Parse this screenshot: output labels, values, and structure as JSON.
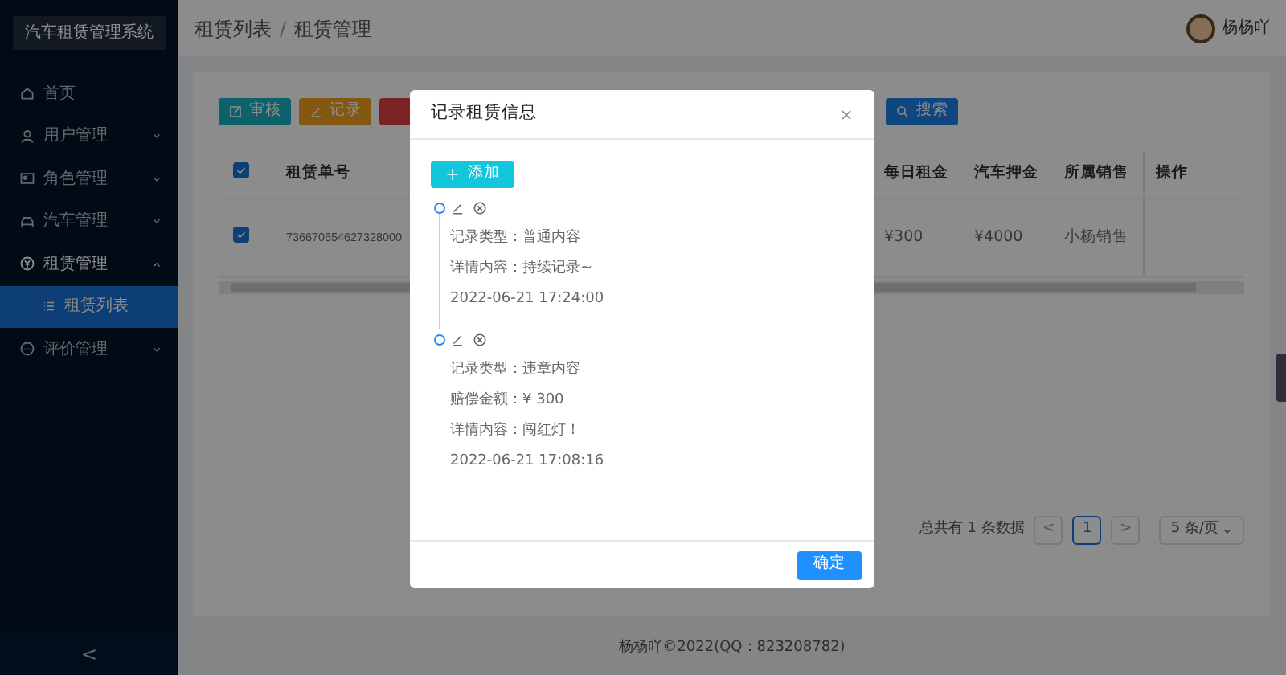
{
  "sidebar": {
    "title": "汽车租赁管理系统",
    "collapse": "<",
    "items": [
      {
        "label": "首页",
        "selected": false
      },
      {
        "label": "用户管理",
        "selected": false,
        "expanded": false
      },
      {
        "label": "角色管理",
        "selected": false,
        "expanded": false
      },
      {
        "label": "汽车管理",
        "selected": false,
        "expanded": false
      },
      {
        "label": "租赁管理",
        "selected": false,
        "expanded": true,
        "children": [
          {
            "label": "租赁列表",
            "selected": true
          }
        ]
      },
      {
        "label": "评价管理",
        "selected": false,
        "expanded": false
      }
    ]
  },
  "header": {
    "breadcrumb": [
      "租赁列表",
      "租赁管理"
    ],
    "breadcrumb_separator": "/",
    "user": "杨杨吖"
  },
  "toolbar": [
    {
      "kind": "review",
      "label": "审核"
    },
    {
      "kind": "record",
      "label": "记录"
    },
    {
      "kind": "delete"
    },
    {
      "kind": "search",
      "label": "搜索"
    }
  ],
  "table": {
    "select_all": {
      "checked": true
    },
    "columns": [
      "租赁单号",
      "每日租金",
      "汽车押金",
      "所属销售",
      "操作"
    ],
    "rows": [
      {
        "checked": true,
        "cells": [
          "736670654627328000",
          "¥300",
          "¥4000",
          "小杨销售"
        ]
      }
    ]
  },
  "pagination": {
    "total": "总共有 1 条数据",
    "prev": "<",
    "pages": [
      {
        "label": "1",
        "selected": true
      }
    ],
    "next": ">",
    "page_size": "5 条/页"
  },
  "footer": "杨杨吖©2022(QQ：823208782)",
  "modal": {
    "title": "记录租赁信息",
    "add_button": "添加",
    "confirm": "确定",
    "records": [
      {
        "lines": [
          "记录类型：普通内容",
          "详情内容：持续记录~"
        ],
        "time": "2022-06-21 17:24:00"
      },
      {
        "lines": [
          "记录类型：违章内容",
          "赔偿金额：¥ 300",
          "详情内容：闯红灯！"
        ],
        "time": "2022-06-21 17:08:16"
      }
    ]
  }
}
